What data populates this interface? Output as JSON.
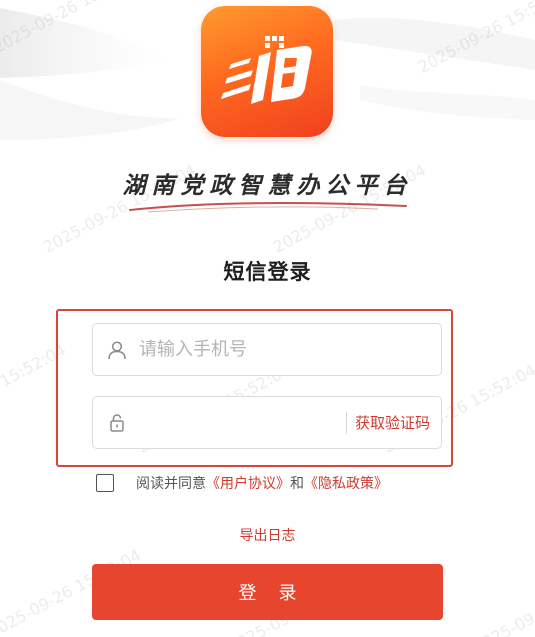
{
  "app": {
    "title": "湖南党政智慧办公平台"
  },
  "login": {
    "heading": "短信登录",
    "phone_placeholder": "请输入手机号",
    "phone_value": "",
    "code_value": "",
    "get_code_label": "获取验证码",
    "agree_prefix": "阅读并同意",
    "user_agreement": "《用户协议》",
    "agree_and": "和",
    "privacy_policy": "《隐私政策》",
    "agreed": false,
    "export_log_label": "导出日志",
    "submit_label": "登录"
  },
  "watermark": {
    "text": "2025-09-26 15:52:04"
  },
  "icons": {
    "logo": "app-logo",
    "phone": "user-icon",
    "code": "lock-icon"
  },
  "colors": {
    "accent": "#e8452f",
    "link": "#d03b2e",
    "logo_gradient_start": "#ff9a2e",
    "logo_gradient_end": "#f0401f"
  }
}
